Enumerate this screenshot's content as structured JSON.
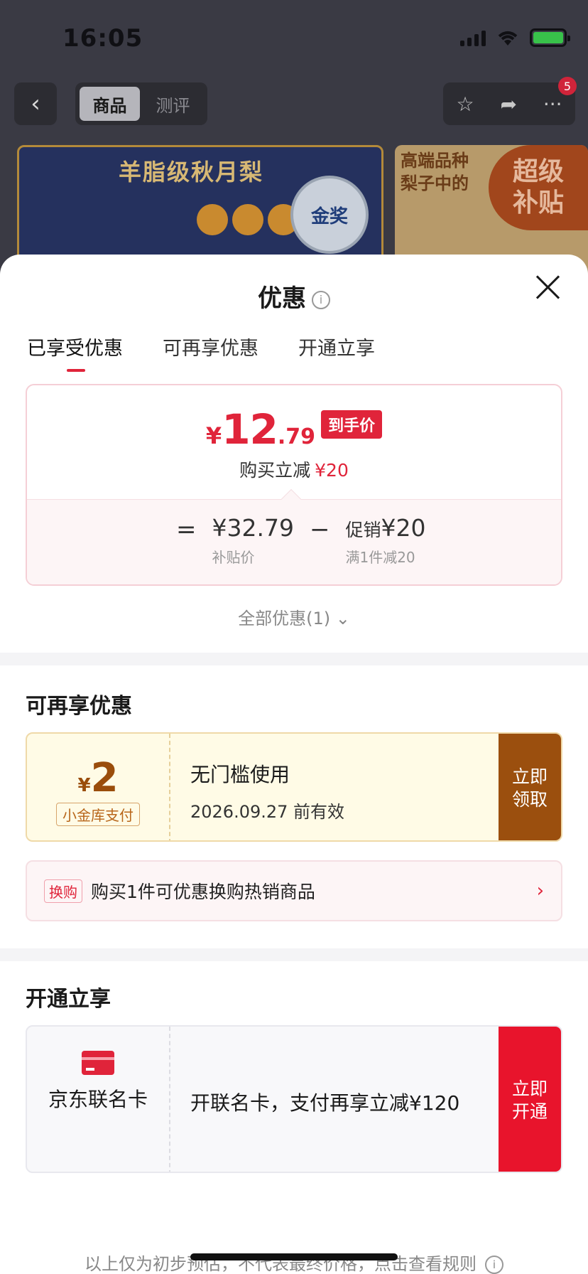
{
  "status": {
    "time": "16:05"
  },
  "nav": {
    "segments": [
      "商品",
      "测评"
    ],
    "badge_count": "5"
  },
  "banners": {
    "left_title": "羊脂级秋月梨",
    "left_seal": "金奖",
    "right_text_line1": "高端品种",
    "right_text_line2": "梨子中的",
    "super_line1": "超级",
    "super_line2": "补贴"
  },
  "sheet": {
    "title": "优惠",
    "tabs": [
      "已享受优惠",
      "可再享优惠",
      "开通立享"
    ],
    "price": {
      "currency": "¥",
      "integer": "12",
      "decimal": ".79",
      "tag": "到手价",
      "sub_label": "购买立减",
      "sub_value": "¥20",
      "eq": "=",
      "minus": "−",
      "base_value": "¥32.79",
      "base_note": "补贴价",
      "promo_label": "促销",
      "promo_value": "¥20",
      "promo_note": "满1件减20"
    },
    "all_deals": "全部优惠(1)",
    "section_more": "可再享优惠",
    "coupon": {
      "currency": "¥",
      "amount": "2",
      "source": "小金库支付",
      "line1": "无门槛使用",
      "line2": "2026.09.27 前有效",
      "button_line1": "立即",
      "button_line2": "领取"
    },
    "swap": {
      "tag": "换购",
      "text": "购买1件可优惠换购热销商品"
    },
    "section_open": "开通立享",
    "card": {
      "name": "京东联名卡",
      "offer": "开联名卡，支付再享立减¥120",
      "button_line1": "立即",
      "button_line2": "开通"
    },
    "footnote": "以上仅为初步预估，不代表最终价格，点击查看规则"
  }
}
